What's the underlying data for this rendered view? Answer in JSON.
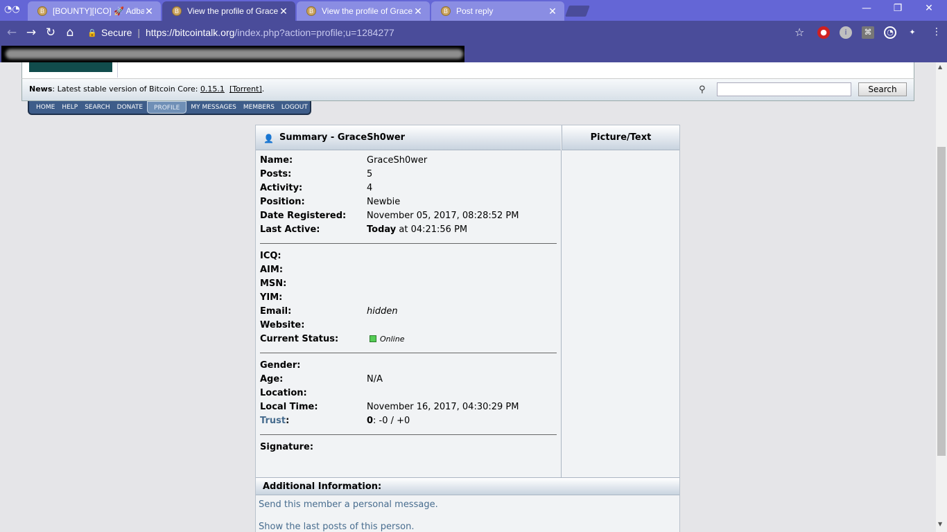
{
  "tabs": [
    {
      "title": "[BOUNTY][ICO] 🚀 Adba",
      "fav": "B"
    },
    {
      "title": "View the profile of Grace",
      "fav": "B"
    },
    {
      "title": "View the profile of Grace",
      "fav": "B"
    },
    {
      "title": "Post reply",
      "fav": "B"
    }
  ],
  "window": {
    "minimize": "—",
    "restore": "❐",
    "close": "✕"
  },
  "toolbar": {
    "secure": "Secure",
    "url_host": "https://bitcointalk.org",
    "url_path": "/index.php?action=profile;u=1284277"
  },
  "news": {
    "label": "News",
    "text": ": Latest stable version of Bitcoin Core: ",
    "version": "0.15.1",
    "torrent": "[Torrent]",
    "end": "."
  },
  "search": {
    "button": "Search",
    "placeholder": ""
  },
  "menu": [
    "HOME",
    "HELP",
    "SEARCH",
    "DONATE",
    "PROFILE",
    "MY MESSAGES",
    "MEMBERS",
    "LOGOUT"
  ],
  "summary": {
    "header": "Summary - GraceSh0wer",
    "picture_header": "Picture/Text",
    "name_label": "Name:",
    "name": "GraceSh0wer",
    "posts_label": "Posts:",
    "posts": "5",
    "activity_label": "Activity:",
    "activity": "4",
    "position_label": "Position:",
    "position": "Newbie",
    "registered_label": "Date Registered:",
    "registered": "November 05, 2017, 08:28:52 PM",
    "last_active_label": "Last Active:",
    "last_active_day": "Today",
    "last_active_time": " at 04:21:56 PM",
    "icq_label": "ICQ:",
    "aim_label": "AIM:",
    "msn_label": "MSN:",
    "yim_label": "YIM:",
    "email_label": "Email:",
    "email": "hidden",
    "website_label": "Website:",
    "status_label": "Current Status:",
    "status": "Online",
    "gender_label": "Gender:",
    "age_label": "Age:",
    "age": "N/A",
    "location_label": "Location:",
    "local_time_label": "Local Time:",
    "local_time": "November 16, 2017, 04:30:29 PM",
    "trust_label": "Trust",
    "trust_colon": ":",
    "trust_score": "0",
    "trust_detail": ": -0 / +0",
    "signature_label": "Signature:"
  },
  "additional": {
    "header": "Additional Information:",
    "pm_link": "Send this member a personal message.",
    "posts_link": "Show the last posts of this person."
  }
}
